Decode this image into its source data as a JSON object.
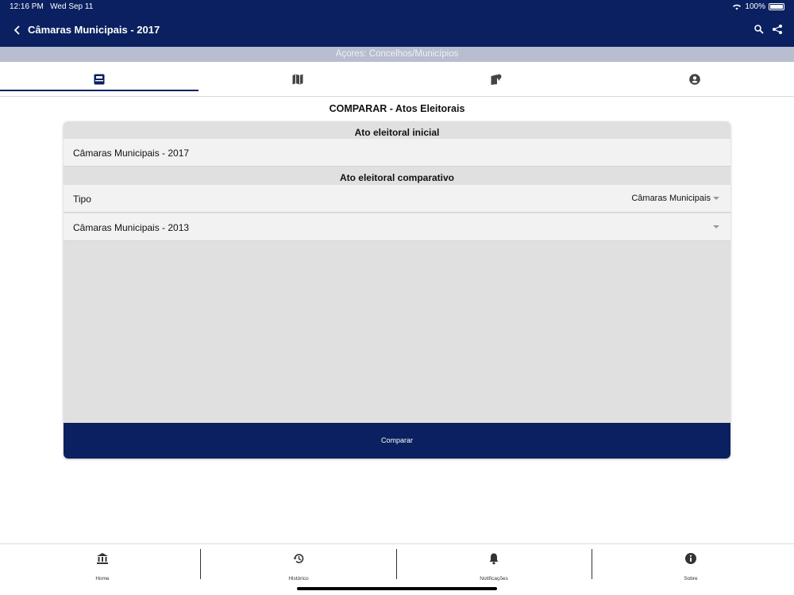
{
  "status": {
    "time": "12:16 PM",
    "date": "Wed Sep 11",
    "battery": "100%"
  },
  "nav": {
    "title": "Câmaras Municipais - 2017"
  },
  "region": {
    "label": "Açores: Concelhos/Municípios"
  },
  "tabs": [
    {
      "icon": "ballot-box-icon",
      "active": true
    },
    {
      "icon": "map-icon",
      "active": false
    },
    {
      "icon": "map-pin-icon",
      "active": false
    },
    {
      "icon": "person-pin-icon",
      "active": false
    }
  ],
  "page": {
    "heading": "COMPARAR - Atos Eleitorais"
  },
  "form": {
    "initial_header": "Ato eleitoral inicial",
    "initial_value": "Câmaras Municipais - 2017",
    "comparative_header": "Ato eleitoral comparativo",
    "type_label": "Tipo",
    "type_value": "Câmaras Municipais",
    "election_value": "Câmaras Municipais - 2013",
    "compare_label": "Comparar"
  },
  "bottom_nav": [
    {
      "label": "Home",
      "icon": "bank-icon"
    },
    {
      "label": "Histórico",
      "icon": "history-icon"
    },
    {
      "label": "Notificações",
      "icon": "bell-icon"
    },
    {
      "label": "Sobre",
      "icon": "info-icon"
    }
  ],
  "colors": {
    "primary": "#0a2060",
    "region_bar": "#b8bdd0",
    "card_bg": "#e0e0e0"
  }
}
